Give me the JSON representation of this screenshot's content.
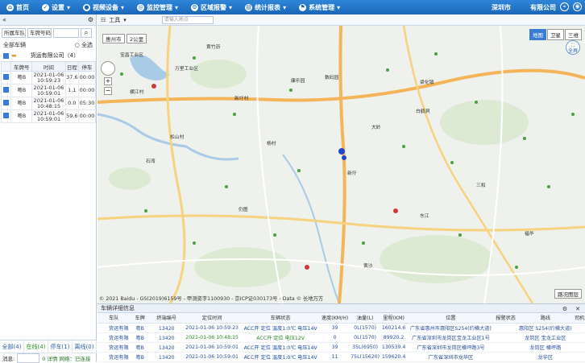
{
  "topnav": {
    "items": [
      {
        "label": "首页",
        "icon": "home-icon"
      },
      {
        "label": "设置",
        "icon": "settings-icon"
      },
      {
        "label": "视频设备",
        "icon": "video-icon"
      },
      {
        "label": "监控管理",
        "icon": "monitor-icon"
      },
      {
        "label": "区域报警",
        "icon": "alarm-icon"
      },
      {
        "label": "统计报表",
        "icon": "report-icon"
      },
      {
        "label": "系统管理",
        "icon": "system-icon"
      }
    ],
    "company": "深圳市　　　有限公司"
  },
  "left": {
    "header_left": "«",
    "filter_team": "所属车队",
    "filter_plate": "车牌号码",
    "all_vehicles": "全部车辆",
    "select_all": "全选",
    "group_label": "　　货运有限公司（4）",
    "columns": [
      "车牌号",
      "时间",
      "日程",
      "停车"
    ],
    "rows": [
      {
        "plate": "粤B　　",
        "time1": "2021-01-06",
        "time2": "10:59:23",
        "mileage": "37.6",
        "stop": "00:00"
      },
      {
        "plate": "粤B　　",
        "time1": "2021-01-06",
        "time2": "10:59:01",
        "mileage": "1.1",
        "stop": "00:00"
      },
      {
        "plate": "粤B　　",
        "time1": "2021-01-06",
        "time2": "10:48:15",
        "mileage": "0.0",
        "stop": "05:30"
      },
      {
        "plate": "粤B　　",
        "time1": "2021-01-06",
        "time2": "10:59:01",
        "mileage": "59.6",
        "stop": "00:00"
      }
    ],
    "footer": [
      "全部(4)",
      "在线(4)",
      "停车(1)",
      "离线(0)"
    ],
    "status_label": "消息:",
    "status_value": "0 详情  网络：已连接"
  },
  "maptool": {
    "tools": "工具",
    "search_placeholder": "请输入地点"
  },
  "map": {
    "city_badge": "惠州市",
    "scale": "2公里",
    "types": [
      "地图",
      "卫星",
      "三维"
    ],
    "fullscreen": "全屏",
    "layer_button": "路况图层",
    "copyright": "© 2021 Baidu - GS(2019)6159号 - 甲测资字1100930 - 京ICP证030173号 - Data © 长地万方",
    "place_labels": [
      "宝昌工业区",
      "万里工业区",
      "横江村",
      "新圩村",
      "康乐园",
      "数码园",
      "梁化镇",
      "松山村",
      "大岭",
      "白鹤洞",
      "黄竹沥",
      "杨村",
      "石湾",
      "新圩",
      "仍图",
      "东江",
      "黄沙",
      "三和",
      "福华"
    ]
  },
  "bottom": {
    "title": "车辆详细信息",
    "columns": [
      "车队",
      "车牌",
      "终端编号",
      "定位时间",
      "车辆状态",
      "速度(KM/H)",
      "油量(L)",
      "里程(KM)",
      "位置",
      "报警状态",
      "路线",
      "司机"
    ],
    "rows": [
      {
        "team": "　　货运有限",
        "plate": "粤B　　",
        "terminal": "13420　　　",
        "time": "2021-01-06 10:59:23",
        "status": "ACC开 定位 温度1:0℃ 电压14V",
        "speed": "39",
        "fuel": "0L(1570)",
        "mile": "160214.6",
        "position": "广东省惠州市惠阳区S254(约横大道)",
        "alarm": "",
        "route": "惠阳区 S254(约横大道)",
        "driver": ""
      },
      {
        "team": "　　货运有限",
        "plate": "粤B　　",
        "terminal": "13420　　　",
        "time": "2021-01-06 10:48:15",
        "status": "ACC开 定位 电压12V",
        "speed": "0",
        "fuel": "0L(1570)",
        "mile": "89920.2",
        "position": "广东省深圳市龙岗区宝龙工业区1号",
        "alarm": "",
        "route": "龙岗区 宝龙工业区",
        "driver": ""
      },
      {
        "team": "　　货运有限",
        "plate": "粤B　　",
        "terminal": "13420　　　",
        "time": "2021-01-06 10:59:01",
        "status": "ACC开 定位 温度1:0℃ 电压14V",
        "speed": "39",
        "fuel": "35L(6950)",
        "mile": "130539.4",
        "position": "广东省深圳市龙岗区横坪路3号",
        "alarm": "",
        "route": "龙岗区 横坪路",
        "driver": ""
      },
      {
        "team": "　　货运有限",
        "plate": "粤B　　",
        "terminal": "13420　　　",
        "time": "2021-01-06 10:59:01",
        "status": "ACC开 定位 温度1:0℃ 电压14V",
        "speed": "11",
        "fuel": "75L(15620)",
        "mile": "159620.4",
        "position": "广东省深圳市龙华区",
        "alarm": "",
        "route": "龙华区",
        "driver": ""
      }
    ]
  }
}
